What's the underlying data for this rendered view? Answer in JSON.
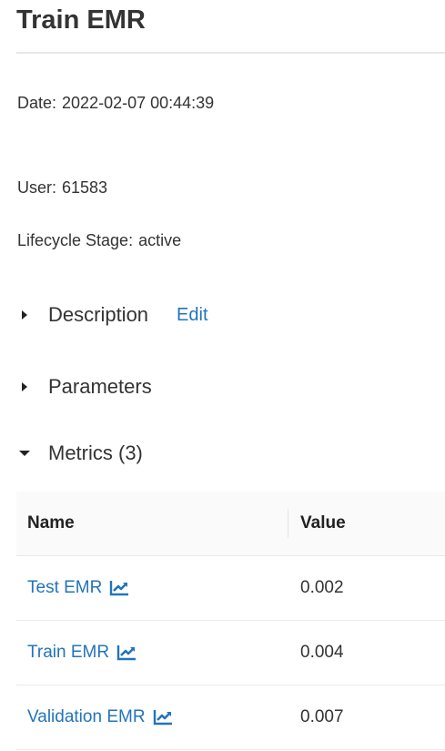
{
  "run": {
    "title": "Train EMR"
  },
  "meta": {
    "date_label": "Date:",
    "date_value": "2022-02-07 00:44:39",
    "user_label": "User:",
    "user_value": "61583",
    "lifecycle_label": "Lifecycle Stage:",
    "lifecycle_value": "active"
  },
  "sections": {
    "description": {
      "label": "Description",
      "edit_label": "Edit",
      "expanded": false
    },
    "parameters": {
      "label": "Parameters",
      "expanded": false
    },
    "metrics": {
      "label": "Metrics (3)",
      "expanded": true
    }
  },
  "metrics_table": {
    "columns": [
      "Name",
      "Value"
    ],
    "rows": [
      {
        "name": "Test EMR",
        "value": "0.002",
        "icon": "line-chart-icon"
      },
      {
        "name": "Train EMR",
        "value": "0.004",
        "icon": "line-chart-icon"
      },
      {
        "name": "Validation EMR",
        "value": "0.007",
        "icon": "line-chart-icon"
      }
    ]
  },
  "colors": {
    "link": "#2374bb",
    "text": "#333333",
    "header_bg": "#fafafa",
    "divider": "#e8e8e8"
  }
}
